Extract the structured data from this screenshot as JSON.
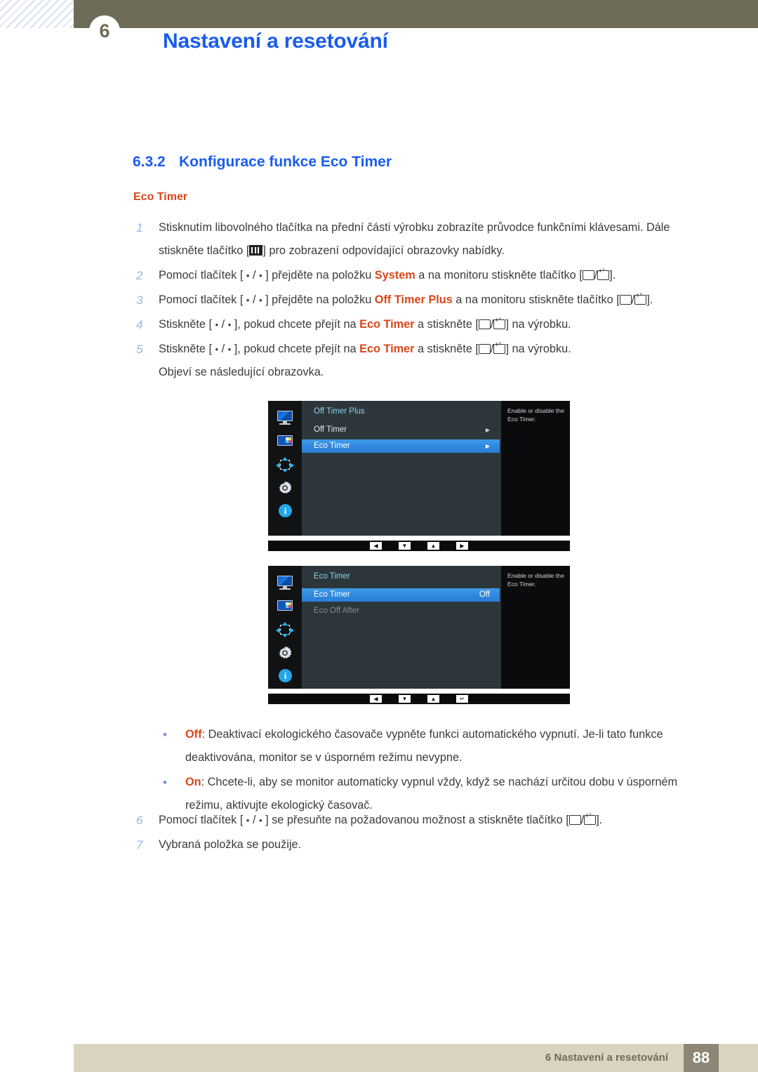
{
  "header": {
    "chapter_number": "6",
    "title": "Nastavení a resetování"
  },
  "section": {
    "number": "6.3.2",
    "title": "Konfigurace funkce Eco Timer",
    "subtitle": "Eco Timer"
  },
  "steps": [
    {
      "num": "1",
      "parts": [
        {
          "t": "text",
          "v": "Stisknutím libovolného tlačítka na přední části výrobku zobrazíte průvodce funkčními klávesami. Dále stiskněte tlačítko ["
        },
        {
          "t": "key",
          "v": "menu-key"
        },
        {
          "t": "text",
          "v": "] pro zobrazení odpovídající obrazovky nabídky."
        }
      ]
    },
    {
      "num": "2",
      "parts": [
        {
          "t": "text",
          "v": "Pomocí tlačítek [ "
        },
        {
          "t": "dot",
          "v": "•"
        },
        {
          "t": "text",
          "v": " / "
        },
        {
          "t": "dot",
          "v": "•"
        },
        {
          "t": "text",
          "v": " ] přejděte na položku "
        },
        {
          "t": "kw",
          "v": "System"
        },
        {
          "t": "text",
          "v": " a na monitoru stiskněte tlačítko ["
        },
        {
          "t": "key",
          "v": "box-key"
        },
        {
          "t": "text",
          "v": "/"
        },
        {
          "t": "key",
          "v": "return-key"
        },
        {
          "t": "text",
          "v": "]."
        }
      ]
    },
    {
      "num": "3",
      "parts": [
        {
          "t": "text",
          "v": "Pomocí tlačítek [ "
        },
        {
          "t": "dot",
          "v": "•"
        },
        {
          "t": "text",
          "v": " / "
        },
        {
          "t": "dot",
          "v": "•"
        },
        {
          "t": "text",
          "v": " ] přejděte na položku "
        },
        {
          "t": "kw",
          "v": "Off Timer Plus"
        },
        {
          "t": "text",
          "v": " a na monitoru stiskněte tlačítko ["
        },
        {
          "t": "key",
          "v": "box-key"
        },
        {
          "t": "text",
          "v": "/"
        },
        {
          "t": "key",
          "v": "return-key"
        },
        {
          "t": "text",
          "v": "]."
        }
      ]
    },
    {
      "num": "4",
      "parts": [
        {
          "t": "text",
          "v": "Stiskněte [ "
        },
        {
          "t": "dot",
          "v": "•"
        },
        {
          "t": "text",
          "v": " / "
        },
        {
          "t": "dot",
          "v": "•"
        },
        {
          "t": "text",
          "v": " ], pokud chcete přejít na "
        },
        {
          "t": "kw",
          "v": "Eco Timer"
        },
        {
          "t": "text",
          "v": " a stiskněte ["
        },
        {
          "t": "key",
          "v": "box-key"
        },
        {
          "t": "text",
          "v": "/"
        },
        {
          "t": "key",
          "v": "return-key"
        },
        {
          "t": "text",
          "v": "] na výrobku."
        }
      ]
    },
    {
      "num": "5",
      "parts": [
        {
          "t": "text",
          "v": "Stiskněte [ "
        },
        {
          "t": "dot",
          "v": "•"
        },
        {
          "t": "text",
          "v": " / "
        },
        {
          "t": "dot",
          "v": "•"
        },
        {
          "t": "text",
          "v": " ], pokud chcete přejít na "
        },
        {
          "t": "kw",
          "v": "Eco Timer"
        },
        {
          "t": "text",
          "v": " a stiskněte ["
        },
        {
          "t": "key",
          "v": "box-key"
        },
        {
          "t": "text",
          "v": "/"
        },
        {
          "t": "key",
          "v": "return-key"
        },
        {
          "t": "text",
          "v": "] na výrobku."
        }
      ],
      "extra": "Objeví se následující obrazovka."
    }
  ],
  "steps_tail": [
    {
      "num": "6",
      "parts": [
        {
          "t": "text",
          "v": "Pomocí tlačítek [ "
        },
        {
          "t": "dot",
          "v": "•"
        },
        {
          "t": "text",
          "v": " / "
        },
        {
          "t": "dot",
          "v": "•"
        },
        {
          "t": "text",
          "v": " ] se přesuňte na požadovanou možnost a stiskněte tlačítko ["
        },
        {
          "t": "key",
          "v": "box-key"
        },
        {
          "t": "text",
          "v": "/"
        },
        {
          "t": "key",
          "v": "return-key"
        },
        {
          "t": "text",
          "v": "]."
        }
      ]
    },
    {
      "num": "7",
      "parts": [
        {
          "t": "text",
          "v": "Vybraná položka se použije."
        }
      ]
    }
  ],
  "bullets": [
    {
      "dot": "•",
      "keyword": "Off",
      "text": ": Deaktivací ekologického časovače vypněte funkci automatického vypnutí. Je-li tato funkce deaktivována, monitor se v úsporném režimu nevypne."
    },
    {
      "dot": "•",
      "keyword": "On",
      "text": ": Chcete-li, aby se monitor automaticky vypnul vždy, když se nachází určitou dobu v úsporném režimu, aktivujte ekologický časovač."
    }
  ],
  "osd_screens": [
    {
      "title": "Off Timer Plus",
      "help": "Enable or disable the Eco Timer.",
      "rows": [
        {
          "label": "Off Timer",
          "value": "",
          "arrow": "▶",
          "selected": false,
          "dim": false
        },
        {
          "label": "Eco Timer",
          "value": "",
          "arrow": "▶",
          "selected": true,
          "dim": false
        }
      ],
      "footer_buttons": [
        "◀",
        "▼",
        "▲",
        "▶"
      ],
      "icons": [
        "monitor-icon",
        "picture-icon",
        "size-position-icon",
        "gear-icon",
        "info-icon"
      ]
    },
    {
      "title": "Eco Timer",
      "help": "Enable or disable the Eco Timer.",
      "rows": [
        {
          "label": "Eco Timer",
          "value": "Off",
          "arrow": "",
          "selected": true,
          "dim": false
        },
        {
          "label": "Eco Off After",
          "value": "",
          "arrow": "",
          "selected": false,
          "dim": true
        }
      ],
      "footer_buttons": [
        "◀",
        "▼",
        "▲",
        "↵"
      ],
      "icons": [
        "monitor-icon",
        "picture-icon",
        "size-position-icon",
        "gear-icon",
        "info-icon"
      ]
    }
  ],
  "footer": {
    "text": "6 Nastavení a resetování",
    "page": "88"
  },
  "colors": {
    "header_band": "#6e6c58",
    "title_blue": "#1a5cf0",
    "keyword_orange": "#d9471a",
    "step_number": "#9bb4e8",
    "footer_bar": "#d9d4c0",
    "footer_page_bg": "#8c8676",
    "osd_highlight": "#2f86de",
    "osd_panel": "#2d373b"
  }
}
